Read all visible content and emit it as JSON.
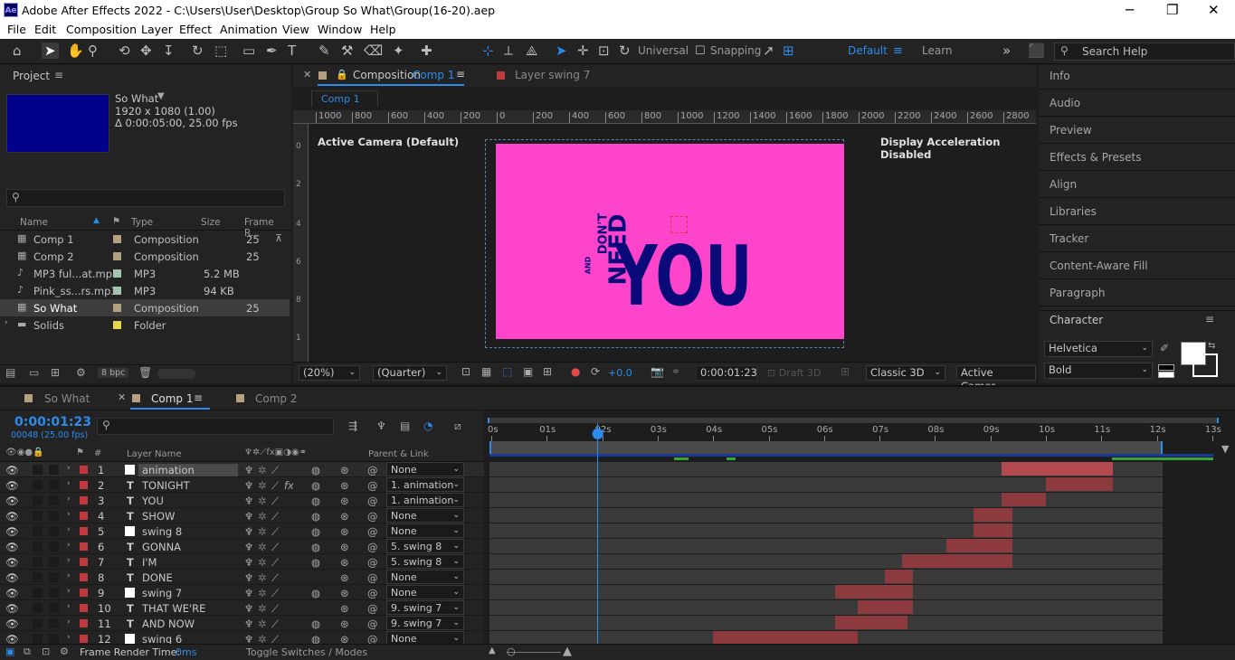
{
  "window": {
    "title": "Adobe After Effects 2022 - C:\\Users\\User\\Desktop\\Group So What\\Group(16-20).aep",
    "logo": "Ae"
  },
  "menu": [
    "File",
    "Edit",
    "Composition",
    "Layer",
    "Effect",
    "Animation",
    "View",
    "Window",
    "Help"
  ],
  "toolbar": {
    "universal": "Universal",
    "snapping": "Snapping",
    "workspace_default": "Default",
    "workspace_learn": "Learn",
    "search_placeholder": "Search Help"
  },
  "project": {
    "title": "Project",
    "comp_name": "So What",
    "comp_size": "1920 x 1080 (1.00)",
    "comp_duration": "Δ 0:00:05:00, 25.00 fps",
    "search_placeholder": "",
    "columns": [
      "Name",
      "Type",
      "Size",
      "Frame R..."
    ],
    "items": [
      {
        "name": "Comp 1",
        "type": "Composition",
        "size": "",
        "fps": "25",
        "color": "#b49f7f"
      },
      {
        "name": "Comp 2",
        "type": "Composition",
        "size": "",
        "fps": "25",
        "color": "#b49f7f"
      },
      {
        "name": "MP3 ful...at.mp3",
        "type": "MP3",
        "size": "5.2 MB",
        "fps": "",
        "color": "#a5c4b0"
      },
      {
        "name": "Pink_ss...rs.mp3",
        "type": "MP3",
        "size": "94 KB",
        "fps": "",
        "color": "#a5c4b0"
      },
      {
        "name": "So What",
        "type": "Composition",
        "size": "",
        "fps": "25",
        "color": "#b49f7f"
      },
      {
        "name": "Solids",
        "type": "Folder",
        "size": "",
        "fps": "",
        "color": "#e4d84a"
      }
    ],
    "bpc": "8 bpc"
  },
  "composition": {
    "tab_prefix": "Composition",
    "tab_name": "Comp 1",
    "layer_tab": "Layer  swing 7",
    "breadcrumb": "Comp 1",
    "ruler_labels": [
      "1000",
      "800",
      "600",
      "400",
      "200",
      "0",
      "200",
      "400",
      "600",
      "800",
      "1000",
      "1200",
      "1400",
      "1600",
      "1800",
      "2000",
      "2200",
      "2400",
      "2600",
      "2800"
    ],
    "active_camera": "Active Camera (Default)",
    "display_accel": "Display Acceleration Disabled",
    "art_text": {
      "and": "AND",
      "dont": "DON'T",
      "need": "NEED",
      "you": "YOU"
    },
    "zoom": "(20%)",
    "quality": "(Quarter)",
    "exposure": "+0.0",
    "timecode": "0:00:01:23",
    "draft": "Draft 3D",
    "renderer": "Classic 3D",
    "view": "Active Camer..."
  },
  "right_panels": [
    "Info",
    "Audio",
    "Preview",
    "Effects & Presets",
    "Align",
    "Libraries",
    "Tracker",
    "Content-Aware Fill",
    "Paragraph"
  ],
  "character": {
    "title": "Character",
    "font": "Helvetica",
    "style": "Bold"
  },
  "timeline": {
    "tabs": [
      "So What",
      "Comp 1",
      "Comp 2"
    ],
    "timecode": "0:00:01:23",
    "frames": "00048 (25.00 fps)",
    "col_layer_name": "Layer Name",
    "col_parent": "Parent & Link",
    "ruler": [
      "0s",
      "01s",
      "02s",
      "03s",
      "04s",
      "05s",
      "06s",
      "07s",
      "08s",
      "09s",
      "10s",
      "11s",
      "12s",
      "13s"
    ],
    "layers": [
      {
        "num": "1",
        "type": "solid",
        "name": "animation",
        "parent": "None"
      },
      {
        "num": "2",
        "type": "T",
        "name": "TONIGHT",
        "parent": "1. animation"
      },
      {
        "num": "3",
        "type": "T",
        "name": "YOU",
        "parent": "1. animation"
      },
      {
        "num": "4",
        "type": "T",
        "name": "SHOW",
        "parent": "None"
      },
      {
        "num": "5",
        "type": "solid",
        "name": "swing 8",
        "parent": "None"
      },
      {
        "num": "6",
        "type": "T",
        "name": "GONNA",
        "parent": "5. swing 8"
      },
      {
        "num": "7",
        "type": "T",
        "name": "I'M",
        "parent": "5. swing 8"
      },
      {
        "num": "8",
        "type": "T",
        "name": "DONE",
        "parent": "None"
      },
      {
        "num": "9",
        "type": "solid",
        "name": "swing 7",
        "parent": "None"
      },
      {
        "num": "10",
        "type": "T",
        "name": "THAT WE'RE",
        "parent": "9. swing 7"
      },
      {
        "num": "11",
        "type": "T",
        "name": "AND NOW",
        "parent": "9. swing 7"
      },
      {
        "num": "12",
        "type": "solid",
        "name": "swing 6",
        "parent": "None"
      }
    ],
    "bars_seconds": [
      [
        9.2,
        11.2
      ],
      [
        10.0,
        11.2
      ],
      [
        9.2,
        10.0
      ],
      [
        8.7,
        9.4
      ],
      [
        8.7,
        9.4
      ],
      [
        8.2,
        9.4
      ],
      [
        7.4,
        9.4
      ],
      [
        7.1,
        7.6
      ],
      [
        6.2,
        7.6
      ],
      [
        6.6,
        7.6
      ],
      [
        6.2,
        7.5
      ],
      [
        4.0,
        6.6
      ]
    ],
    "frame_render_label": "Frame Render Time:",
    "frame_render_value": "0ms",
    "toggle": "Toggle Switches / Modes"
  }
}
